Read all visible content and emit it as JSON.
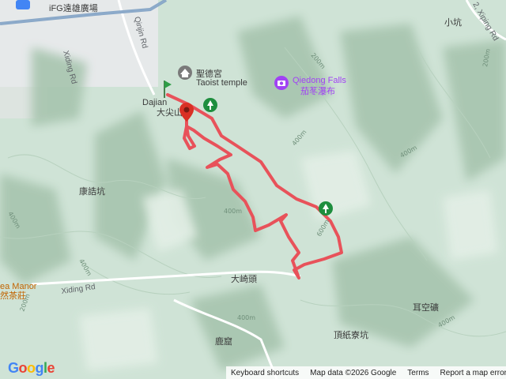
{
  "map": {
    "top_labels": {
      "ifg_plaza": "iFG遠雄廣場",
      "qinjin_rd": "Qinjin Rd",
      "xiding_rd_north": "Xiding Rd",
      "xiping_rd": "2, Xiping Rd",
      "xiaokeng": "小坑"
    },
    "places": {
      "shengde_temple_zh": "聖德宮",
      "shengde_temple_en": "Taoist temple",
      "qiedong_falls_en": "Qiedong Falls",
      "qiedong_falls_zh": "茄苳瀑布",
      "dajian_en": "Dajian",
      "dajian_zh": "大尖山",
      "kangjiekeng": "康誥坑",
      "daqitou": "大崎頭",
      "tea_manor_en": "ea Manor",
      "tea_manor_zh": "然茶莊",
      "xiding_rd_south": "Xiding Rd",
      "luku": "鹿窟",
      "dingzhiliaokeng": "頂紙寮坑",
      "erkongkuang": "耳空礦"
    },
    "contours": [
      "200m",
      "400m",
      "400m",
      "400m",
      "600m",
      "400m",
      "400m",
      "200m",
      "200m",
      "400m",
      "400m"
    ],
    "colors": {
      "track": "#e8525a",
      "terrain": "#cfe3d6",
      "relief": "#a9c7b1",
      "start_marker": "#2e9d46",
      "end_marker": "#d93025",
      "poi_purple": "#a142f4",
      "poi_green": "#1e8e3e"
    },
    "icons": {
      "start": "green-flag-marker",
      "end": "red-pin-marker",
      "temple": "temple-icon",
      "falls": "camera-icon",
      "park1": "tree-icon",
      "park2": "tree-icon"
    }
  },
  "footer": {
    "logo": [
      "G",
      "o",
      "o",
      "g",
      "l",
      "e"
    ],
    "keyboard_shortcuts": "Keyboard shortcuts",
    "map_data": "Map data ©2026 Google",
    "terms": "Terms",
    "report": "Report a map error"
  }
}
